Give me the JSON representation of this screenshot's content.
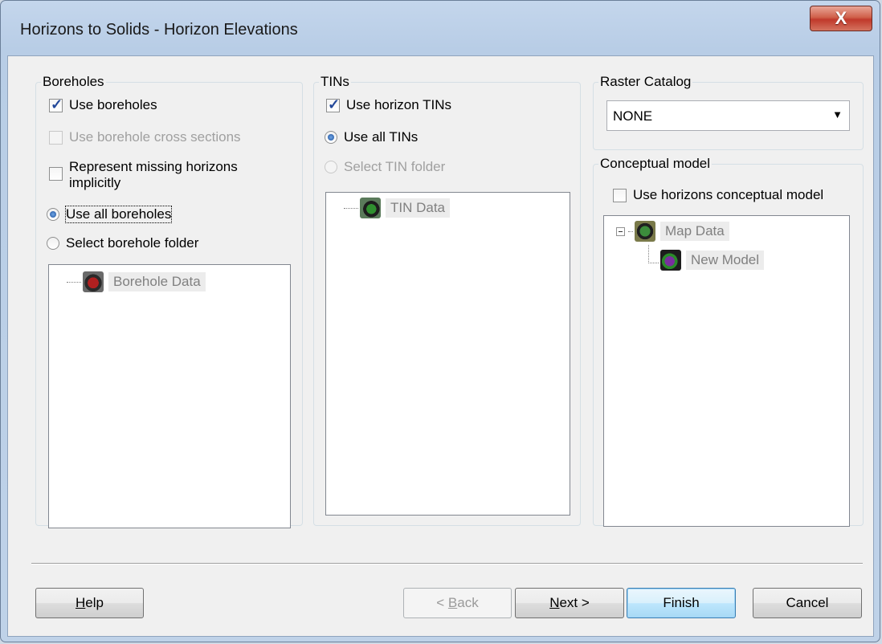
{
  "window": {
    "title": "Horizons to Solids - Horizon Elevations",
    "close_glyph": "X"
  },
  "boreholes": {
    "legend": "Boreholes",
    "use_boreholes": "Use boreholes",
    "use_cross_sections": "Use borehole cross sections",
    "represent_missing_1": "Represent missing horizons",
    "represent_missing_2": "implicitly",
    "use_all": "Use all boreholes",
    "select_folder": "Select borehole folder",
    "tree_root": "Borehole Data"
  },
  "tins": {
    "legend": "TINs",
    "use_horizon_tins": "Use horizon TINs",
    "use_all": "Use all TINs",
    "select_folder": "Select TIN folder",
    "tree_root": "TIN Data"
  },
  "raster": {
    "legend": "Raster Catalog",
    "selected": "NONE"
  },
  "conceptual": {
    "legend": "Conceptual model",
    "use_model": "Use horizons conceptual model",
    "tree_root": "Map Data",
    "tree_child": "New Model"
  },
  "buttons": {
    "help_mn": "H",
    "help_rest": "elp",
    "back_pre": "< ",
    "back_mn": "B",
    "back_rest": "ack",
    "next_mn": "N",
    "next_rest": "ext >",
    "finish": "Finish",
    "cancel": "Cancel"
  }
}
